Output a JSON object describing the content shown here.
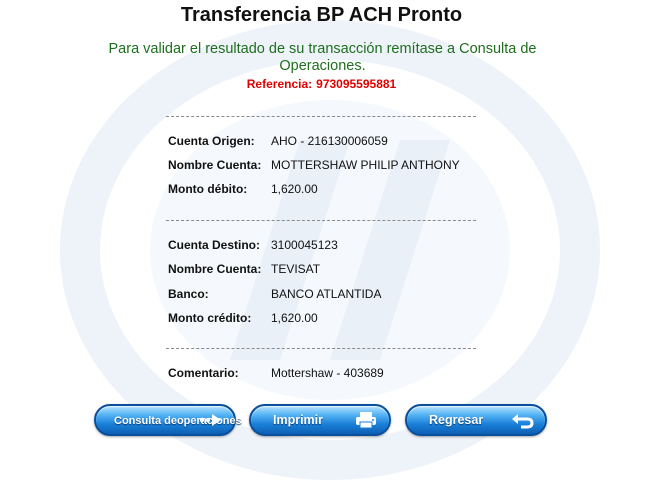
{
  "page": {
    "title": "Transferencia BP ACH Pronto",
    "subtitle": "Para validar el resultado de su transacción remítase a Consulta de Operaciones.",
    "reference_label": "Referencia:",
    "reference_value": "973095595881"
  },
  "origin": {
    "account_label": "Cuenta Origen:",
    "account_value": "AHO - 216130006059",
    "name_label": "Nombre Cuenta:",
    "name_value": "MOTTERSHAW PHILIP ANTHONY",
    "debit_label": "Monto débito:",
    "debit_value": "1,620.00"
  },
  "destination": {
    "account_label": "Cuenta Destino:",
    "account_value": "3100045123",
    "name_label": "Nombre Cuenta:",
    "name_value": "TEVISAT",
    "bank_label": "Banco:",
    "bank_value": "BANCO ATLANTIDA",
    "credit_label": "Monto crédito:",
    "credit_value": "1,620.00"
  },
  "comment": {
    "label": "Comentario:",
    "value": "Mottershaw - 403689"
  },
  "buttons": {
    "consult_line1": "Consulta de",
    "consult_line2": "operaciones",
    "print": "Imprimir",
    "back": "Regresar"
  },
  "colors": {
    "subtitle": "#1e6e1e",
    "reference": "#e00000",
    "button": "#1a7fd8"
  },
  "icons": {
    "consult": "arrow-right-icon",
    "print": "printer-icon",
    "back": "return-arrow-icon",
    "watermark": "bank-logo-watermark"
  }
}
